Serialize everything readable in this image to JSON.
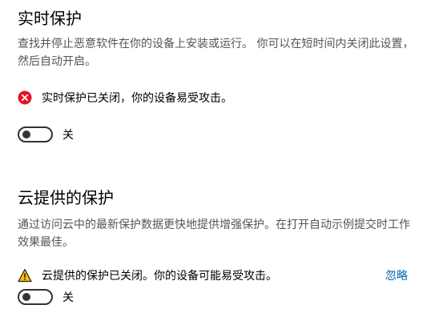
{
  "realtime": {
    "title": "实时保护",
    "description": "查找并停止恶意软件在你的设备上安装或运行。 你可以在短时间内关闭此设置，然后自动开启。",
    "status_text": "实时保护已关闭，你的设备易受攻击。",
    "status_icon": "error-circle-icon",
    "status_color": "#e81123",
    "toggle_state": "关"
  },
  "cloud": {
    "title": "云提供的保护",
    "description": "通过访问云中的最新保护数据更快地提供增强保护。在打开自动示例提交时工作效果最佳。",
    "status_text": "云提供的保护已关闭。你的设备可能易受攻击。",
    "status_icon": "warning-triangle-icon",
    "warning_color": "#ffb900",
    "dismiss_label": "忽略",
    "toggle_state": "关"
  }
}
